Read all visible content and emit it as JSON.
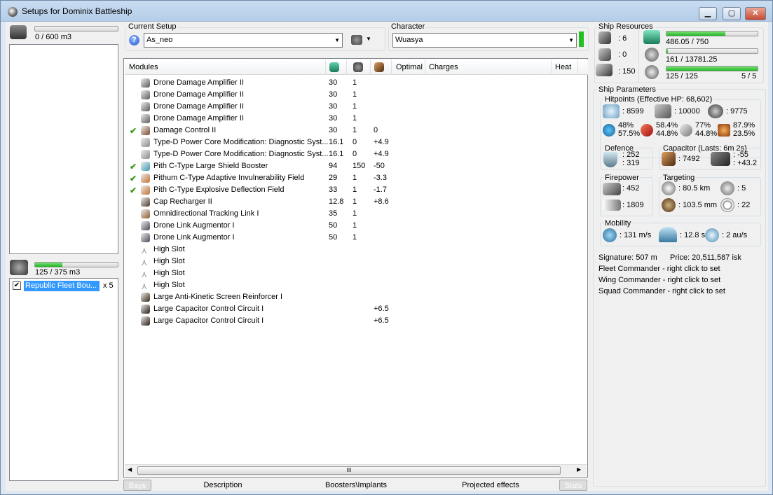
{
  "window": {
    "title": "Setups for Dominix Battleship",
    "minimize": "▁",
    "maximize": "▢",
    "close": "✕"
  },
  "cargo": {
    "capacity": "0 / 600 m3"
  },
  "drone_bay": {
    "capacity": "125 / 375 m3",
    "fill": 0.33,
    "drone_name": "Republic Fleet Bou...",
    "drone_count": "x 5"
  },
  "setup": {
    "label": "Current Setup",
    "value": "As_neo",
    "help_icon": "?"
  },
  "character": {
    "label": "Character",
    "value": "Wuasya"
  },
  "modules": {
    "headers": {
      "name": "Modules",
      "optimal": "Optimal",
      "charges": "Charges",
      "heat": "Heat"
    },
    "rows": [
      {
        "check": "",
        "name": "Drone Damage Amplifier II",
        "cpu": "30",
        "pg": "1",
        "cap": "",
        "color": "#5b5b5b"
      },
      {
        "check": "",
        "name": "Drone Damage Amplifier II",
        "cpu": "30",
        "pg": "1",
        "cap": "",
        "color": "#5b5b5b"
      },
      {
        "check": "",
        "name": "Drone Damage Amplifier II",
        "cpu": "30",
        "pg": "1",
        "cap": "",
        "color": "#5b5b5b"
      },
      {
        "check": "",
        "name": "Drone Damage Amplifier II",
        "cpu": "30",
        "pg": "1",
        "cap": "",
        "color": "#5b5b5b"
      },
      {
        "check": "✔",
        "name": "Damage Control II",
        "cpu": "30",
        "pg": "1",
        "cap": "0",
        "color": "#7a4a2a"
      },
      {
        "check": "",
        "name": "Type-D Power Core Modification: Diagnostic Syst...",
        "cpu": "16.1",
        "pg": "0",
        "cap": "+4.9",
        "color": "#8a8a8a"
      },
      {
        "check": "",
        "name": "Type-D Power Core Modification: Diagnostic Syst...",
        "cpu": "16.1",
        "pg": "0",
        "cap": "+4.9",
        "color": "#8a8a8a"
      },
      {
        "check": "✔",
        "name": "Pith C-Type Large Shield Booster",
        "cpu": "94",
        "pg": "150",
        "cap": "-50",
        "color": "#3c9ab5"
      },
      {
        "check": "✔",
        "name": "Pithum C-Type Adaptive Invulnerability Field",
        "cpu": "29",
        "pg": "1",
        "cap": "-3.3",
        "color": "#c07030"
      },
      {
        "check": "✔",
        "name": "Pith C-Type Explosive Deflection Field",
        "cpu": "33",
        "pg": "1",
        "cap": "-1.7",
        "color": "#c07030"
      },
      {
        "check": "",
        "name": "Cap Recharger II",
        "cpu": "12.8",
        "pg": "1",
        "cap": "+8.6",
        "color": "#4a3a2a"
      },
      {
        "check": "",
        "name": "Omnidirectional Tracking Link I",
        "cpu": "35",
        "pg": "1",
        "cap": "",
        "color": "#8a5a30"
      },
      {
        "check": "",
        "name": "Drone Link Augmentor I",
        "cpu": "50",
        "pg": "1",
        "cap": "",
        "color": "#4a4a5a"
      },
      {
        "check": "",
        "name": "Drone Link Augmentor I",
        "cpu": "50",
        "pg": "1",
        "cap": "",
        "color": "#4a4a5a"
      },
      {
        "check": "",
        "name": "High Slot",
        "cpu": "",
        "pg": "",
        "cap": "",
        "color": ""
      },
      {
        "check": "",
        "name": "High Slot",
        "cpu": "",
        "pg": "",
        "cap": "",
        "color": ""
      },
      {
        "check": "",
        "name": "High Slot",
        "cpu": "",
        "pg": "",
        "cap": "",
        "color": ""
      },
      {
        "check": "",
        "name": "High Slot",
        "cpu": "",
        "pg": "",
        "cap": "",
        "color": ""
      },
      {
        "check": "",
        "name": "Large Anti-Kinetic Screen Reinforcer I",
        "cpu": "",
        "pg": "",
        "cap": "",
        "color": "#3a2a1a"
      },
      {
        "check": "",
        "name": "Large Capacitor Control Circuit I",
        "cpu": "",
        "pg": "",
        "cap": "+6.5",
        "color": "#2a1a10"
      },
      {
        "check": "",
        "name": "Large Capacitor Control Circuit I",
        "cpu": "",
        "pg": "",
        "cap": "+6.5",
        "color": "#2a1a10"
      }
    ],
    "scroll_thumb": "III"
  },
  "tabs": {
    "bays": "Bays",
    "description": "Description",
    "boosters": "Boosters\\Implants",
    "projected": "Projected effects",
    "stats": "Stats"
  },
  "resources": {
    "label": "Ship Resources",
    "turrets": ": 6",
    "launchers": ": 0",
    "drone_bandwidth": ": 150",
    "cpu": {
      "text": "486.05 / 750",
      "fill": 0.648
    },
    "powergrid": {
      "text": "161 / 13781.25",
      "fill": 0.012
    },
    "drones": {
      "text": "125 / 125",
      "count": "5 / 5",
      "fill": 1.0
    }
  },
  "params": {
    "label": "Ship Parameters",
    "hitpoints": {
      "label": "Hitpoints (Effective HP: 68,602)",
      "shield": ": 8599",
      "armor": ": 10000",
      "structure": ": 9775",
      "res_em_top": "48%",
      "res_em_bottom": "57.5%",
      "res_th_top": "58.4%",
      "res_th_bottom": "44.8%",
      "res_ki_top": "77%",
      "res_ki_bottom": "44.8%",
      "res_ex_top": "87.9%",
      "res_ex_bottom": "23.5%"
    },
    "defence": {
      "label": "Defence",
      "top": ": 252",
      "bottom": ": 319"
    },
    "capacitor": {
      "label": "Capacitor (Lasts: 6m 2s)",
      "capacity": ": 7492",
      "top": ": -55",
      "bottom": ": +43.2"
    },
    "firepower": {
      "label": "Firepower",
      "top": ": 452",
      "bottom": ": 1809"
    },
    "targeting": {
      "label": "Targeting",
      "range": ": 80.5 km",
      "targets": ": 5",
      "scan": ": 103.5 mm",
      "sensor": ": 22"
    },
    "mobility": {
      "label": "Mobility",
      "speed": ": 131 m/s",
      "align": ": 12.8 s",
      "warp": ": 2 au/s"
    },
    "signature": "Signature: 507 m",
    "price": "Price: 20,511,587 isk",
    "fleet": "Fleet Commander - right click to set",
    "wing": "Wing Commander - right click to set",
    "squad": "Squad Commander - right click to set"
  }
}
